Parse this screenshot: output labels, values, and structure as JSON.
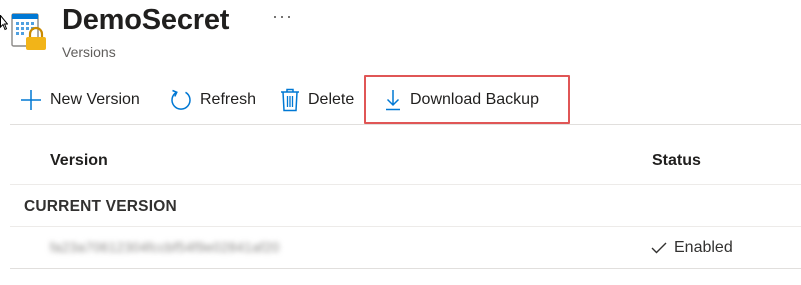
{
  "header": {
    "title": "DemoSecret",
    "subtitle": "Versions",
    "more_label": "···"
  },
  "toolbar": {
    "new_version_label": "New Version",
    "refresh_label": "Refresh",
    "delete_label": "Delete",
    "download_backup_label": "Download Backup"
  },
  "table": {
    "columns": [
      "Version",
      "Status"
    ],
    "group_label": "CURRENT VERSION",
    "rows": [
      {
        "version_id": "fa23a70612304fccbf54f9e02841af20",
        "status": "Enabled"
      }
    ]
  },
  "colors": {
    "accent": "#0078d4",
    "highlight_border": "#e05656",
    "icon_gold": "#f2b418"
  },
  "icons": [
    "mouse-cursor-icon",
    "key-vault-secret-icon",
    "plus-icon",
    "refresh-icon",
    "trash-icon",
    "download-icon",
    "checkmark-icon"
  ]
}
